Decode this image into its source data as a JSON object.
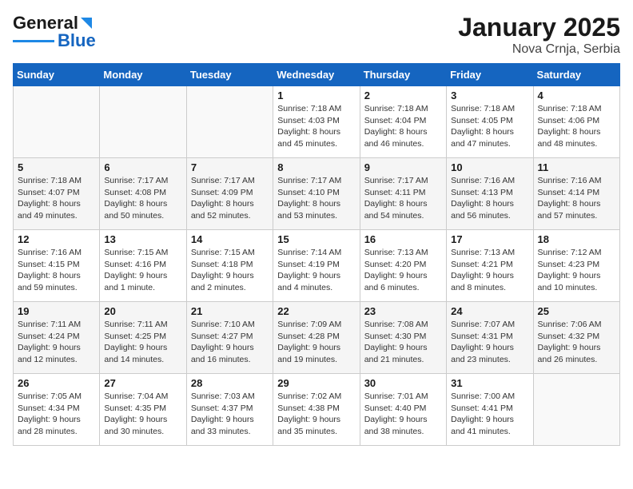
{
  "header": {
    "logo_line1": "General",
    "logo_line2": "Blue",
    "title": "January 2025",
    "subtitle": "Nova Crnja, Serbia"
  },
  "weekdays": [
    "Sunday",
    "Monday",
    "Tuesday",
    "Wednesday",
    "Thursday",
    "Friday",
    "Saturday"
  ],
  "weeks": [
    [
      {
        "day": "",
        "info": ""
      },
      {
        "day": "",
        "info": ""
      },
      {
        "day": "",
        "info": ""
      },
      {
        "day": "1",
        "info": "Sunrise: 7:18 AM\nSunset: 4:03 PM\nDaylight: 8 hours\nand 45 minutes."
      },
      {
        "day": "2",
        "info": "Sunrise: 7:18 AM\nSunset: 4:04 PM\nDaylight: 8 hours\nand 46 minutes."
      },
      {
        "day": "3",
        "info": "Sunrise: 7:18 AM\nSunset: 4:05 PM\nDaylight: 8 hours\nand 47 minutes."
      },
      {
        "day": "4",
        "info": "Sunrise: 7:18 AM\nSunset: 4:06 PM\nDaylight: 8 hours\nand 48 minutes."
      }
    ],
    [
      {
        "day": "5",
        "info": "Sunrise: 7:18 AM\nSunset: 4:07 PM\nDaylight: 8 hours\nand 49 minutes."
      },
      {
        "day": "6",
        "info": "Sunrise: 7:17 AM\nSunset: 4:08 PM\nDaylight: 8 hours\nand 50 minutes."
      },
      {
        "day": "7",
        "info": "Sunrise: 7:17 AM\nSunset: 4:09 PM\nDaylight: 8 hours\nand 52 minutes."
      },
      {
        "day": "8",
        "info": "Sunrise: 7:17 AM\nSunset: 4:10 PM\nDaylight: 8 hours\nand 53 minutes."
      },
      {
        "day": "9",
        "info": "Sunrise: 7:17 AM\nSunset: 4:11 PM\nDaylight: 8 hours\nand 54 minutes."
      },
      {
        "day": "10",
        "info": "Sunrise: 7:16 AM\nSunset: 4:13 PM\nDaylight: 8 hours\nand 56 minutes."
      },
      {
        "day": "11",
        "info": "Sunrise: 7:16 AM\nSunset: 4:14 PM\nDaylight: 8 hours\nand 57 minutes."
      }
    ],
    [
      {
        "day": "12",
        "info": "Sunrise: 7:16 AM\nSunset: 4:15 PM\nDaylight: 8 hours\nand 59 minutes."
      },
      {
        "day": "13",
        "info": "Sunrise: 7:15 AM\nSunset: 4:16 PM\nDaylight: 9 hours\nand 1 minute."
      },
      {
        "day": "14",
        "info": "Sunrise: 7:15 AM\nSunset: 4:18 PM\nDaylight: 9 hours\nand 2 minutes."
      },
      {
        "day": "15",
        "info": "Sunrise: 7:14 AM\nSunset: 4:19 PM\nDaylight: 9 hours\nand 4 minutes."
      },
      {
        "day": "16",
        "info": "Sunrise: 7:13 AM\nSunset: 4:20 PM\nDaylight: 9 hours\nand 6 minutes."
      },
      {
        "day": "17",
        "info": "Sunrise: 7:13 AM\nSunset: 4:21 PM\nDaylight: 9 hours\nand 8 minutes."
      },
      {
        "day": "18",
        "info": "Sunrise: 7:12 AM\nSunset: 4:23 PM\nDaylight: 9 hours\nand 10 minutes."
      }
    ],
    [
      {
        "day": "19",
        "info": "Sunrise: 7:11 AM\nSunset: 4:24 PM\nDaylight: 9 hours\nand 12 minutes."
      },
      {
        "day": "20",
        "info": "Sunrise: 7:11 AM\nSunset: 4:25 PM\nDaylight: 9 hours\nand 14 minutes."
      },
      {
        "day": "21",
        "info": "Sunrise: 7:10 AM\nSunset: 4:27 PM\nDaylight: 9 hours\nand 16 minutes."
      },
      {
        "day": "22",
        "info": "Sunrise: 7:09 AM\nSunset: 4:28 PM\nDaylight: 9 hours\nand 19 minutes."
      },
      {
        "day": "23",
        "info": "Sunrise: 7:08 AM\nSunset: 4:30 PM\nDaylight: 9 hours\nand 21 minutes."
      },
      {
        "day": "24",
        "info": "Sunrise: 7:07 AM\nSunset: 4:31 PM\nDaylight: 9 hours\nand 23 minutes."
      },
      {
        "day": "25",
        "info": "Sunrise: 7:06 AM\nSunset: 4:32 PM\nDaylight: 9 hours\nand 26 minutes."
      }
    ],
    [
      {
        "day": "26",
        "info": "Sunrise: 7:05 AM\nSunset: 4:34 PM\nDaylight: 9 hours\nand 28 minutes."
      },
      {
        "day": "27",
        "info": "Sunrise: 7:04 AM\nSunset: 4:35 PM\nDaylight: 9 hours\nand 30 minutes."
      },
      {
        "day": "28",
        "info": "Sunrise: 7:03 AM\nSunset: 4:37 PM\nDaylight: 9 hours\nand 33 minutes."
      },
      {
        "day": "29",
        "info": "Sunrise: 7:02 AM\nSunset: 4:38 PM\nDaylight: 9 hours\nand 35 minutes."
      },
      {
        "day": "30",
        "info": "Sunrise: 7:01 AM\nSunset: 4:40 PM\nDaylight: 9 hours\nand 38 minutes."
      },
      {
        "day": "31",
        "info": "Sunrise: 7:00 AM\nSunset: 4:41 PM\nDaylight: 9 hours\nand 41 minutes."
      },
      {
        "day": "",
        "info": ""
      }
    ]
  ]
}
